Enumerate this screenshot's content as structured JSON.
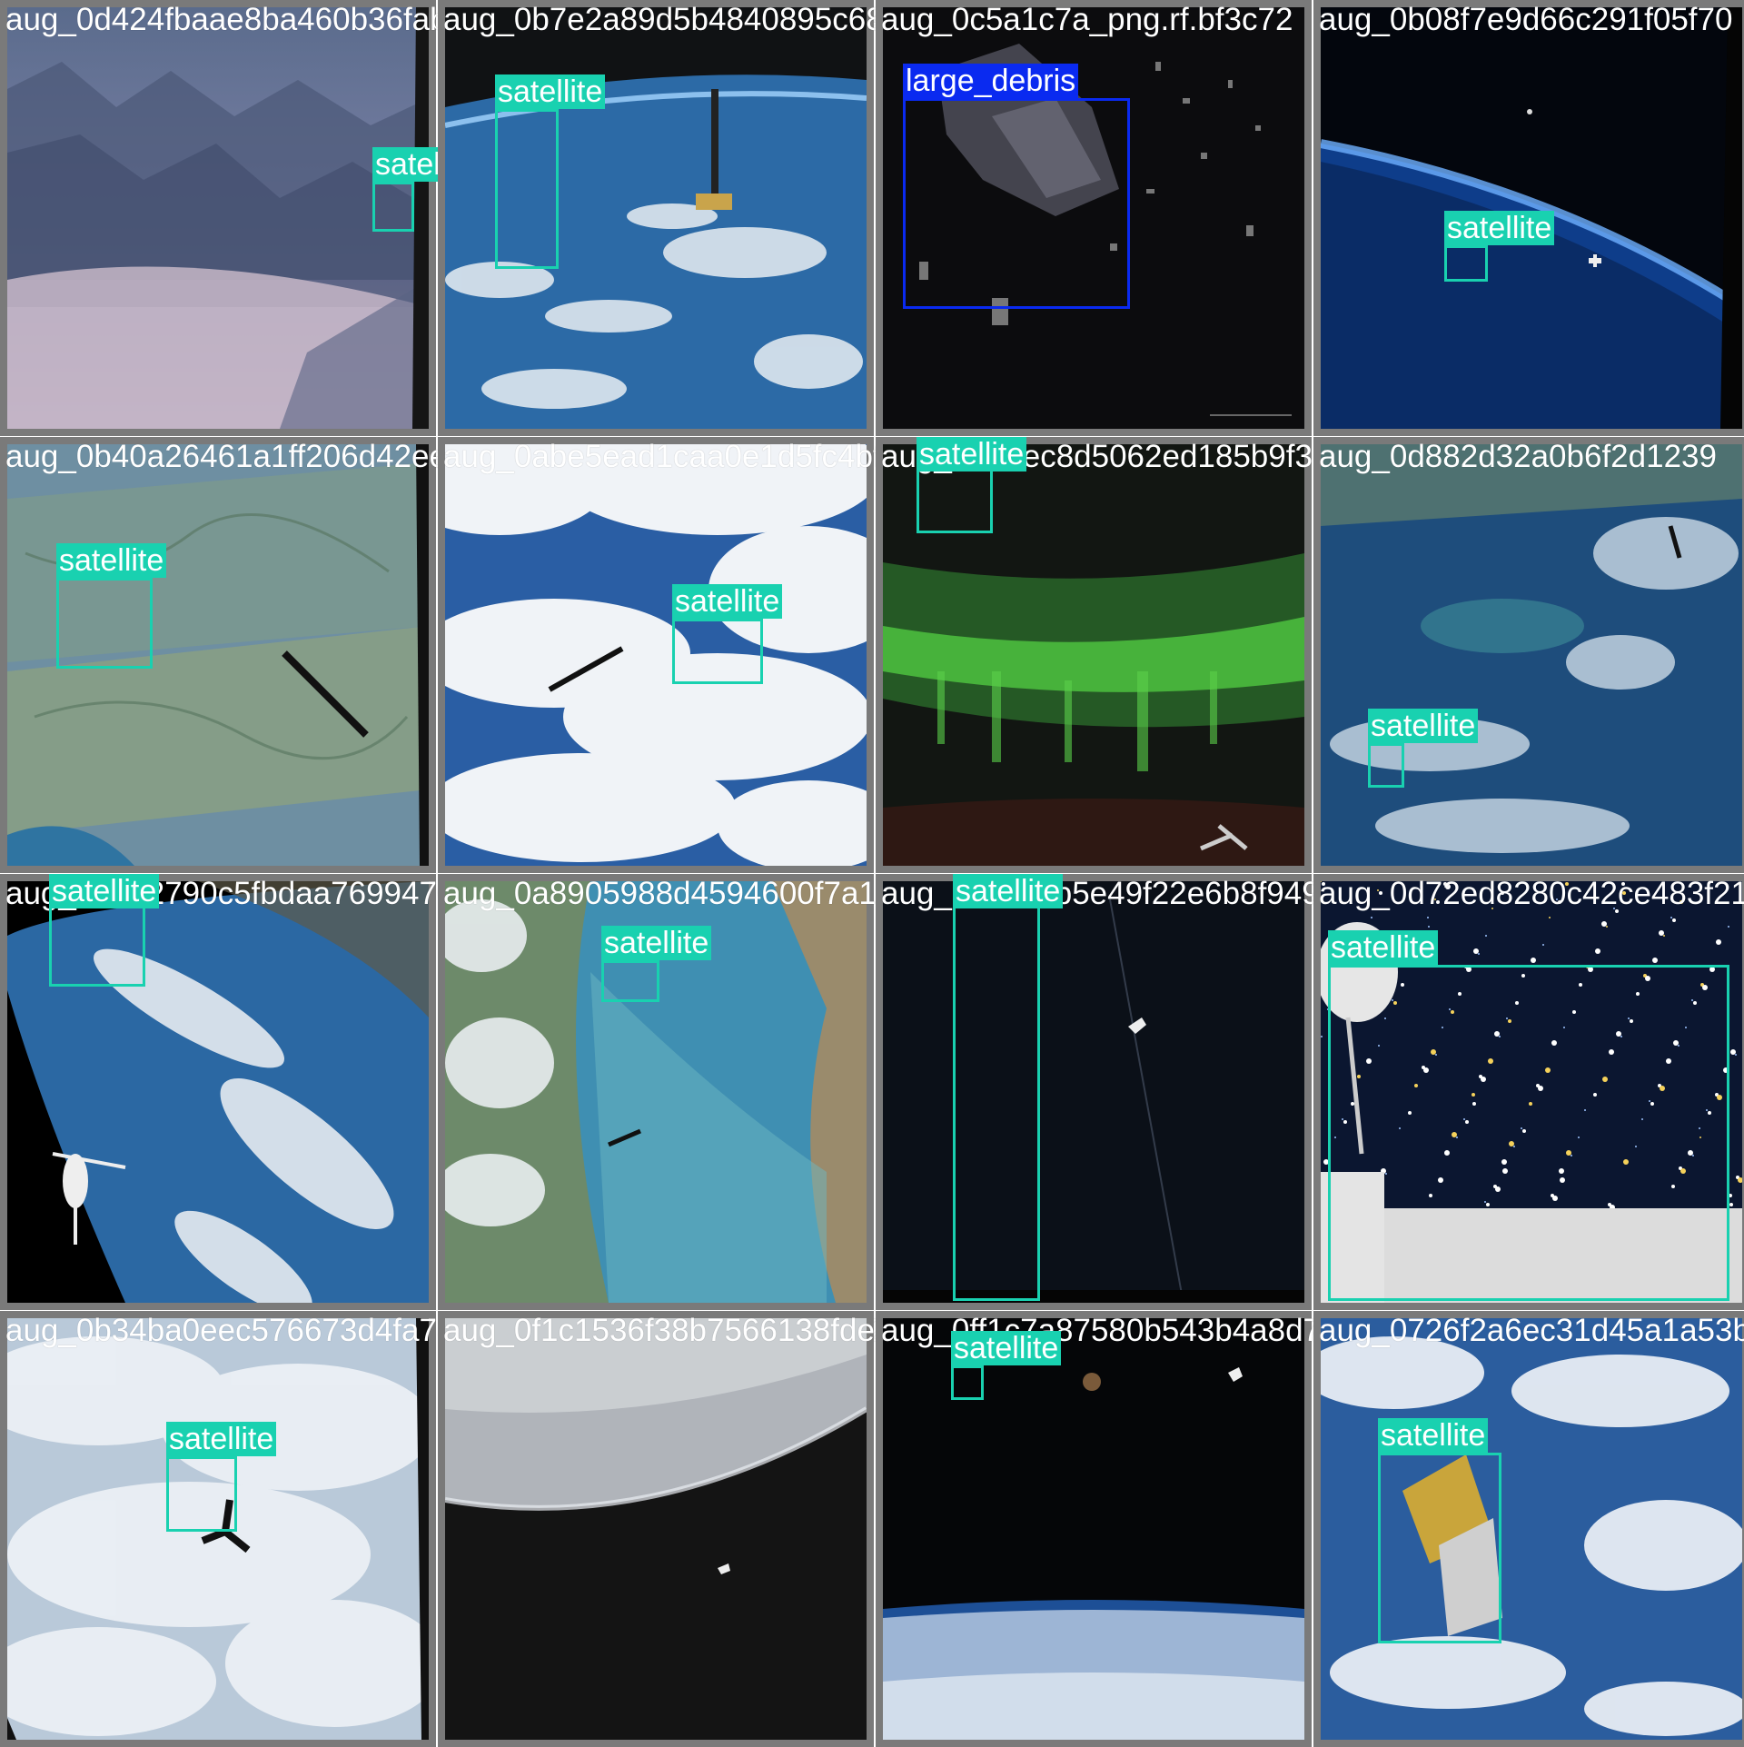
{
  "colors": {
    "satellite": "#19d1b0",
    "large_debris": "#0a2af0",
    "frame": "#7a7a7a"
  },
  "tiles": [
    {
      "filename": "aug_0d424fbaae8ba460b36fabe2a8954840895c687bb1643541c5.PNG.jpg",
      "scene": "mountains",
      "boxes": [
        {
          "label": "satellite",
          "class": "satellite"
        }
      ]
    },
    {
      "filename": "aug_0b7e2a89d5b4840895c687bb1643541c5.PNG.jpg",
      "scene": "earth-limb",
      "boxes": [
        {
          "label": "satellite",
          "class": "satellite"
        }
      ]
    },
    {
      "filename": "aug_0c5a1c7a_png.rf.bf3c72",
      "scene": "debris",
      "boxes": [
        {
          "label": "large_debris",
          "class": "large_debris"
        }
      ]
    },
    {
      "filename": "aug_0b08f7e9d66c291f05f70",
      "scene": "limb-blue",
      "boxes": [
        {
          "label": "satellite",
          "class": "satellite"
        }
      ]
    },
    {
      "filename": "aug_0b40a26461a1ff206d42eeb1abe5ead1caa0e1d5fc4",
      "scene": "valley",
      "boxes": [
        {
          "label": "satellite",
          "class": "satellite"
        }
      ]
    },
    {
      "filename": "aug_0abe5ead1caa0e1d5fc4bf1c2da7bec8d5062ed185b9f",
      "scene": "clouds",
      "boxes": [
        {
          "label": "satellite",
          "class": "satellite"
        }
      ]
    },
    {
      "filename": "aug_0a7bec8d5062ed185b9f397d882d32a0b6f2d1239",
      "scene": "aurora",
      "boxes": [
        {
          "label": "satellite",
          "class": "satellite"
        }
      ]
    },
    {
      "filename": "aug_0d882d32a0b6f2d1239",
      "scene": "ocean",
      "boxes": [
        {
          "label": "satellite",
          "class": "satellite"
        }
      ]
    },
    {
      "filename": "aug_0b5e2790c5fbdaa7699470d0a8905988d4594600f7",
      "scene": "curve",
      "boxes": [
        {
          "label": "satellite",
          "class": "satellite"
        }
      ]
    },
    {
      "filename": "aug_0a8905988d4594600f7a1d5c88c5b5e49f22e6b8f",
      "scene": "coast",
      "boxes": [
        {
          "label": "satellite",
          "class": "satellite"
        }
      ]
    },
    {
      "filename": "aug_0c88c5b5e49f22e6b8f9490d72ed8280c42ce483f213",
      "scene": "darksky",
      "boxes": [
        {
          "label": "satellite",
          "class": "satellite"
        }
      ]
    },
    {
      "filename": "aug_0d72ed8280c42ce483f213",
      "scene": "stars",
      "boxes": [
        {
          "label": "satellite",
          "class": "satellite"
        }
      ]
    },
    {
      "filename": "aug_0b34ba0eec576673d4fa7890f1c1536f38b7566138fde802",
      "scene": "white-clouds",
      "boxes": [
        {
          "label": "satellite",
          "class": "satellite"
        }
      ]
    },
    {
      "filename": "aug_0f1c1536f38b7566138fde802f9ff1c7a87580b543b4",
      "scene": "horizon-gray",
      "boxes": []
    },
    {
      "filename": "aug_0ff1c7a87580b543b4a8d726f2a6ec31d45a1a53b",
      "scene": "moon-limb",
      "boxes": [
        {
          "label": "satellite",
          "class": "satellite"
        }
      ]
    },
    {
      "filename": "aug_0726f2a6ec31d45a1a53b",
      "scene": "solar-panel",
      "boxes": [
        {
          "label": "satellite",
          "class": "satellite"
        }
      ]
    }
  ]
}
